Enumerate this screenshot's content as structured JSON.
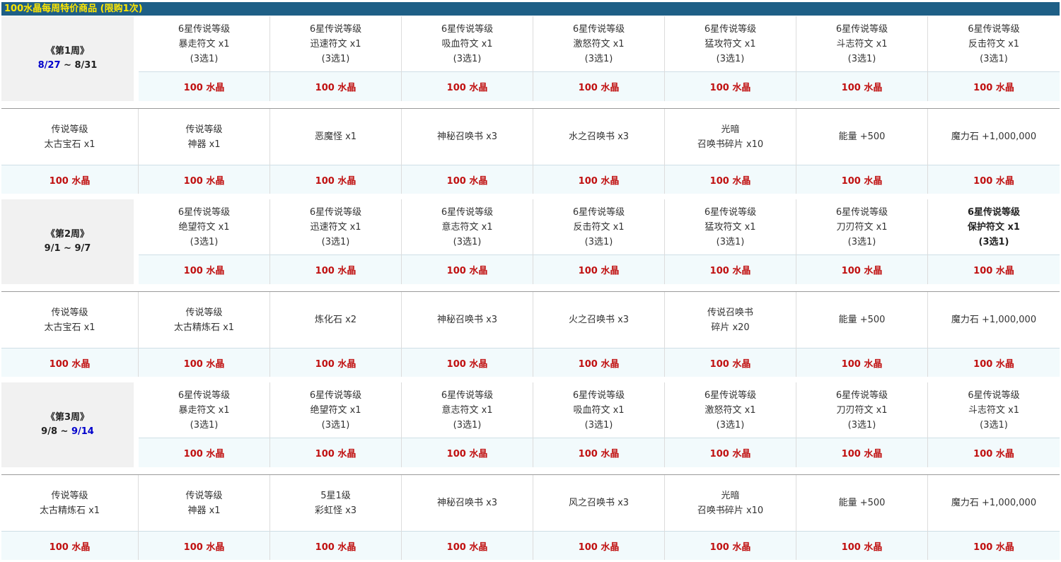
{
  "banner": "100水晶每周特价商品 (限购1次)",
  "price_label": "100 水晶",
  "weeks": [
    {
      "name": "《第1周》",
      "date_start": "8/27",
      "date_sep": " ~ ",
      "date_end": "8/31",
      "start_blue": true,
      "end_blue": false,
      "rowA": [
        [
          "6星传说等级",
          "暴走符文 x1",
          "(3选1)"
        ],
        [
          "6星传说等级",
          "迅速符文 x1",
          "(3选1)"
        ],
        [
          "6星传说等级",
          "吸血符文 x1",
          "(3选1)"
        ],
        [
          "6星传说等级",
          "激怒符文 x1",
          "(3选1)"
        ],
        [
          "6星传说等级",
          "猛攻符文 x1",
          "(3选1)"
        ],
        [
          "6星传说等级",
          "斗志符文 x1",
          "(3选1)"
        ],
        [
          "6星传说等级",
          "反击符文 x1",
          "(3选1)"
        ]
      ],
      "rowB": [
        [
          "传说等级",
          "太古宝石 x1"
        ],
        [
          "传说等级",
          "神器 x1"
        ],
        [
          "恶魔怪 x1"
        ],
        [
          "神秘召唤书 x3"
        ],
        [
          "水之召唤书 x3"
        ],
        [
          "光暗",
          "召唤书碎片 x10"
        ],
        [
          "能量 +500"
        ],
        [
          "魔力石 +1,000,000"
        ]
      ]
    },
    {
      "name": "《第2周》",
      "date_start": "9/1",
      "date_sep": " ~ ",
      "date_end": "9/7",
      "start_blue": false,
      "end_blue": false,
      "rowA": [
        [
          "6星传说等级",
          "绝望符文 x1",
          "(3选1)"
        ],
        [
          "6星传说等级",
          "迅速符文 x1",
          "(3选1)"
        ],
        [
          "6星传说等级",
          "意志符文 x1",
          "(3选1)"
        ],
        [
          "6星传说等级",
          "反击符文 x1",
          "(3选1)"
        ],
        [
          "6星传说等级",
          "猛攻符文 x1",
          "(3选1)"
        ],
        [
          "6星传说等级",
          "刀刃符文 x1",
          "(3选1)"
        ],
        [
          "6星传说等级",
          "保护符文 x1",
          "(3选1)"
        ]
      ],
      "rowB": [
        [
          "传说等级",
          "太古宝石 x1"
        ],
        [
          "传说等级",
          "太古精炼石 x1"
        ],
        [
          "炼化石 x2"
        ],
        [
          "神秘召唤书 x3"
        ],
        [
          "火之召唤书 x3"
        ],
        [
          "传说召唤书",
          "碎片 x20"
        ],
        [
          "能量 +500"
        ],
        [
          "魔力石 +1,000,000"
        ]
      ]
    },
    {
      "name": "《第3周》",
      "date_start": "9/8",
      "date_sep": " ~ ",
      "date_end": "9/14",
      "start_blue": false,
      "end_blue": true,
      "rowA": [
        [
          "6星传说等级",
          "暴走符文 x1",
          "(3选1)"
        ],
        [
          "6星传说等级",
          "绝望符文 x1",
          "(3选1)"
        ],
        [
          "6星传说等级",
          "意志符文 x1",
          "(3选1)"
        ],
        [
          "6星传说等级",
          "吸血符文 x1",
          "(3选1)"
        ],
        [
          "6星传说等级",
          "激怒符文 x1",
          "(3选1)"
        ],
        [
          "6星传说等级",
          "刀刃符文 x1",
          "(3选1)"
        ],
        [
          "6星传说等级",
          "斗志符文 x1",
          "(3选1)"
        ]
      ],
      "rowB": [
        [
          "传说等级",
          "太古精炼石 x1"
        ],
        [
          "传说等级",
          "神器 x1"
        ],
        [
          "5星1级",
          "彩虹怪 x3"
        ],
        [
          "神秘召唤书 x3"
        ],
        [
          "风之召唤书 x3"
        ],
        [
          "光暗",
          "召唤书碎片 x10"
        ],
        [
          "能量 +500"
        ],
        [
          "魔力石 +1,000,000"
        ]
      ]
    }
  ]
}
